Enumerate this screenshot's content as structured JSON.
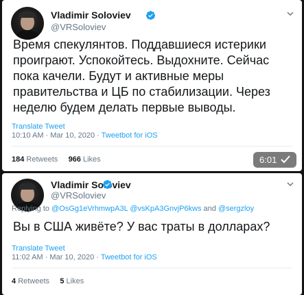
{
  "tweet1": {
    "author_name": "Vladimir Soloviev",
    "author_handle": "@VRSoloviev",
    "text": "Время спекулянтов. Поддавшиеся истерики проиграют. Успокойтесь. Выдохните. Сейчас пока качели. Будут и активные меры правительства и ЦБ по стабилизации. Через неделю будем делать первые выводы.",
    "translate_label": "Translate Tweet",
    "timestamp": "10:10 AM · Mar 10, 2020 · ",
    "client": "Tweetbot for iOS",
    "retweets_count": "184",
    "retweets_label": "Retweets",
    "likes_count": "966",
    "likes_label": "Likes"
  },
  "tweet2": {
    "author_name": "Vladimir Soloviev",
    "author_handle": "@VRSoloviev",
    "replying_prefix": "Replying to ",
    "replying_mention_1": "@OsGg1eVrhmwpA3L",
    "replying_mention_2": "@vsKpA3GnvjP6kws",
    "replying_and": " and ",
    "replying_mention_3": "@sergzloy",
    "text": "Вы в США живёте? У вас траты в долларах?",
    "translate_label": "Translate Tweet",
    "timestamp": "11:02 AM · Mar 10, 2020 · ",
    "client": "Tweetbot for iOS",
    "retweets_count": "4",
    "retweets_label": "Retweets",
    "likes_count": "5",
    "likes_label": "Likes"
  },
  "overlay": {
    "time": "6:01"
  },
  "colors": {
    "verified": "#1da1f2",
    "link": "#1da1f2",
    "secondary_text": "#657786",
    "toast_bg": "#7b7b7b"
  },
  "icons": {
    "verified": "verified-badge-icon",
    "menu": "chevron-down-icon",
    "toast": "checkmark-icon"
  }
}
